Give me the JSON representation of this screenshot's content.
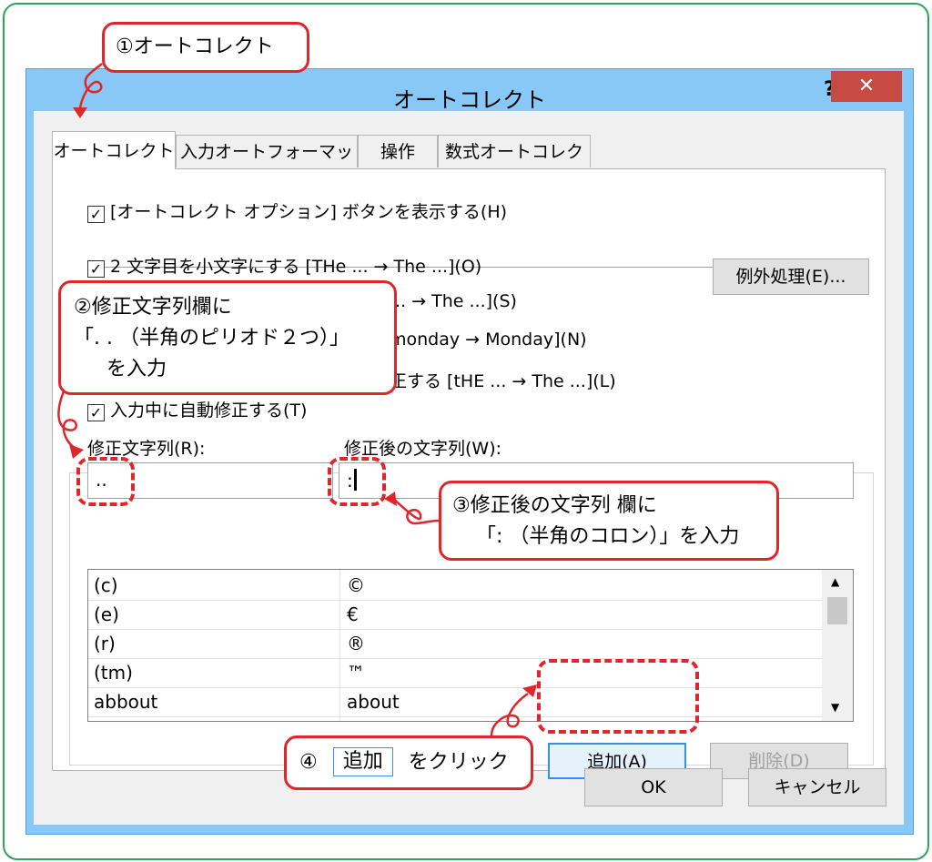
{
  "dialog": {
    "title": "オートコレクト",
    "help": "?",
    "close": "✕",
    "tabs": [
      "オートコレクト",
      "入力オートフォーマット",
      "操作",
      "数式オートコレクト"
    ],
    "options": {
      "show_buttons": "[オートコレクト オプション] ボタンを表示する(H)",
      "second_lower": "2 文字目を小文字にする [THe ... → The ...](O)",
      "sentence_cap": "... → The ...](S)",
      "day_cap": "monday → Monday](N)",
      "caps_lock": "正する [tHE ... → The ...](L)",
      "auto_correct": "入力中に自動修正する(T)"
    },
    "exceptions_button": "例外処理(E)...",
    "replace_label": "修正文字列(R):",
    "with_label": "修正後の文字列(W):",
    "replace_value": "..",
    "with_value": ":",
    "entries": [
      {
        "from": "(c)",
        "to": "©"
      },
      {
        "from": "(e)",
        "to": "€"
      },
      {
        "from": "(r)",
        "to": "®"
      },
      {
        "from": "(tm)",
        "to": "™"
      },
      {
        "from": "abbout",
        "to": "about"
      }
    ],
    "add_button": "追加(A)",
    "delete_button": "削除(D)",
    "ok_button": "OK",
    "cancel_button": "キャンセル"
  },
  "callouts": {
    "c1": "①オートコレクト",
    "c2_line1": "②修正文字列欄に",
    "c2_line2": "「. . （半角のピリオド２つ）」",
    "c2_line3": "を入力",
    "c3_line1": "③修正後の文字列 欄に",
    "c3_line2": "「: （半角のコロン）」を入力",
    "c4_prefix": "④",
    "c4_button": "追加",
    "c4_suffix": "をクリック"
  },
  "colors": {
    "accent": "#e0262a",
    "frame": "#2aa55a",
    "title_bar": "#88c8f7"
  }
}
